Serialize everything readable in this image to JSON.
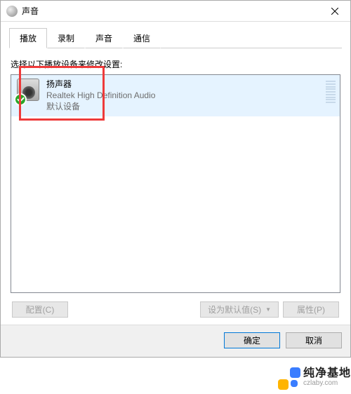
{
  "titlebar": {
    "title": "声音"
  },
  "tabs": [
    {
      "label": "播放",
      "active": true
    },
    {
      "label": "录制",
      "active": false
    },
    {
      "label": "声音",
      "active": false
    },
    {
      "label": "通信",
      "active": false
    }
  ],
  "instruction": "选择以下播放设备来修改设置:",
  "devices": [
    {
      "name": "扬声器",
      "description": "Realtek High Definition Audio",
      "status": "默认设备",
      "default": true,
      "selected": true
    }
  ],
  "buttons": {
    "configure": "配置(C)",
    "set_default": "设为默认值(S)",
    "properties": "属性(P)",
    "ok": "确定",
    "cancel": "取消"
  },
  "watermark": {
    "cn": "纯净基地",
    "en": "czlaby.com"
  }
}
